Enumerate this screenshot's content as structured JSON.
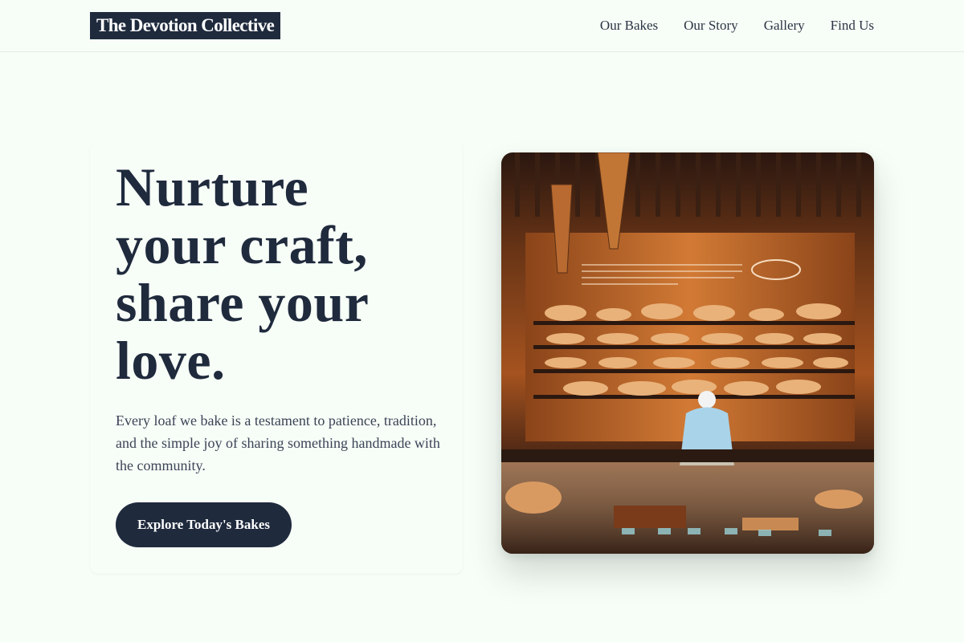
{
  "header": {
    "brand": "The Devotion Collective",
    "nav": [
      "Our Bakes",
      "Our Story",
      "Gallery",
      "Find Us"
    ]
  },
  "hero": {
    "headline_lines": [
      "Nurture",
      "your craft,",
      "share your",
      "love."
    ],
    "lede": "Every loaf we bake is a testament to patience, tradition, and the simple joy of sharing something handmade with the community.",
    "cta": "Explore Today's Bakes",
    "image_description_icon": "bakery-photo"
  },
  "colors": {
    "background": "#f7fdf7",
    "ink": "#1f2a3d",
    "body_text": "#3b4456",
    "photo_warm": "#c8692a"
  }
}
